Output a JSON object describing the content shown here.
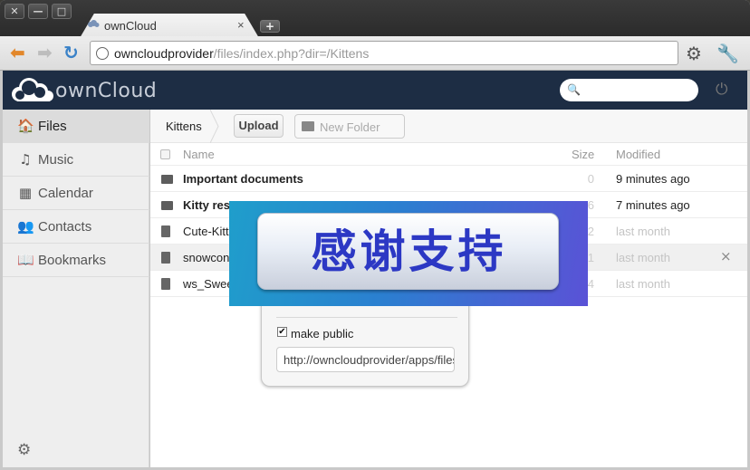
{
  "browser": {
    "window_buttons": [
      "✕",
      "—",
      "□"
    ],
    "tab_title": "ownCloud",
    "tab_close": "×",
    "new_tab": "+",
    "url_host": "owncloudprovider",
    "url_path": "/files/index.php?dir=/Kittens"
  },
  "header": {
    "logo_text": "ownCloud",
    "search_value": ""
  },
  "sidebar": {
    "items": [
      {
        "label": "Files",
        "icon": "🏠"
      },
      {
        "label": "Music",
        "icon": "♫"
      },
      {
        "label": "Calendar",
        "icon": "▦"
      },
      {
        "label": "Contacts",
        "icon": "👥"
      },
      {
        "label": "Bookmarks",
        "icon": "📖"
      }
    ]
  },
  "controls": {
    "breadcrumb": "Kittens",
    "upload_label": "Upload",
    "new_folder_placeholder": "New Folder"
  },
  "table": {
    "headers": {
      "name": "Name",
      "size": "Size",
      "modified": "Modified"
    },
    "rows": [
      {
        "name": "Important documents",
        "size": "0",
        "modified": "9 minutes ago",
        "type": "folder"
      },
      {
        "name": "Kitty res",
        "size": "6",
        "modified": "7 minutes ago",
        "type": "folder"
      },
      {
        "name": "Cute-Kitt",
        "size": "2",
        "modified": "last month",
        "type": "file"
      },
      {
        "name": "snowcone",
        "size": "1",
        "modified": "last month",
        "type": "file"
      },
      {
        "name": "ws_Swee",
        "size": "4",
        "modified": "last month",
        "type": "file"
      }
    ],
    "row_close": "×"
  },
  "share": {
    "make_public_label": "make public",
    "checked_mark": "✔",
    "link_value": "http://owncloudprovider/apps/files_sharing/get.php"
  },
  "banner": {
    "text": "感谢支持"
  }
}
